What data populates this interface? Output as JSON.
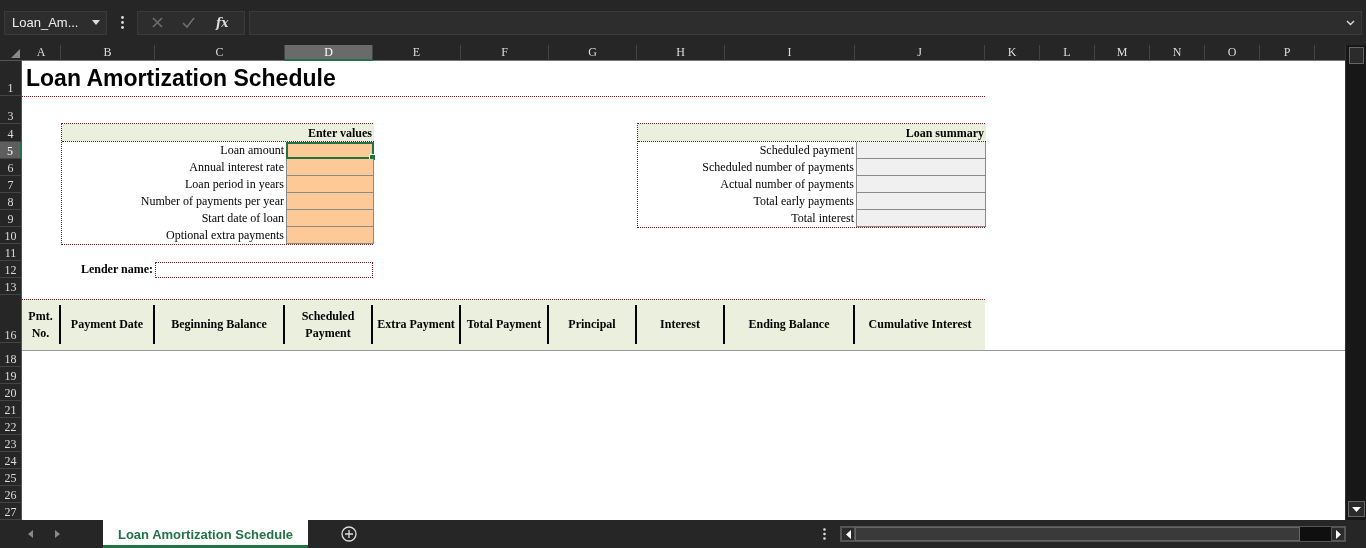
{
  "name_box": {
    "value": "Loan_Am..."
  },
  "formula_bar": {
    "function_label": "fx"
  },
  "columns": [
    {
      "label": "A",
      "selected": false
    },
    {
      "label": "B",
      "selected": false
    },
    {
      "label": "C",
      "selected": false
    },
    {
      "label": "D",
      "selected": true
    },
    {
      "label": "E",
      "selected": false
    },
    {
      "label": "F",
      "selected": false
    },
    {
      "label": "G",
      "selected": false
    },
    {
      "label": "H",
      "selected": false
    },
    {
      "label": "I",
      "selected": false
    },
    {
      "label": "J",
      "selected": false
    },
    {
      "label": "K",
      "selected": false
    },
    {
      "label": "L",
      "selected": false
    },
    {
      "label": "M",
      "selected": false
    },
    {
      "label": "N",
      "selected": false
    },
    {
      "label": "O",
      "selected": false
    },
    {
      "label": "P",
      "selected": false
    }
  ],
  "rows": [
    {
      "label": "1",
      "selected": false
    },
    {
      "label": "3",
      "selected": false
    },
    {
      "label": "4",
      "selected": false
    },
    {
      "label": "5",
      "selected": true
    },
    {
      "label": "6",
      "selected": false
    },
    {
      "label": "7",
      "selected": false
    },
    {
      "label": "8",
      "selected": false
    },
    {
      "label": "9",
      "selected": false
    },
    {
      "label": "10",
      "selected": false
    },
    {
      "label": "11",
      "selected": false
    },
    {
      "label": "12",
      "selected": false
    },
    {
      "label": "13",
      "selected": false
    },
    {
      "label": "16",
      "selected": false
    },
    {
      "label": "18",
      "selected": false
    },
    {
      "label": "19",
      "selected": false
    },
    {
      "label": "20",
      "selected": false
    },
    {
      "label": "21",
      "selected": false
    },
    {
      "label": "22",
      "selected": false
    },
    {
      "label": "23",
      "selected": false
    },
    {
      "label": "24",
      "selected": false
    },
    {
      "label": "25",
      "selected": false
    },
    {
      "label": "26",
      "selected": false
    },
    {
      "label": "27",
      "selected": false
    }
  ],
  "title": "Loan Amortization Schedule",
  "input_table": {
    "heading": "Enter values",
    "fields": [
      {
        "label": "Loan amount",
        "selected": true
      },
      {
        "label": "Annual interest rate",
        "selected": false
      },
      {
        "label": "Loan period in years",
        "selected": false
      },
      {
        "label": "Number of payments per year",
        "selected": false
      },
      {
        "label": "Start date of loan",
        "selected": false
      },
      {
        "label": "Optional extra payments",
        "selected": false
      }
    ]
  },
  "lender": {
    "label": "Lender name:"
  },
  "summary": {
    "heading": "Loan summary",
    "fields": [
      {
        "label": "Scheduled payment"
      },
      {
        "label": "Scheduled number of payments"
      },
      {
        "label": "Actual number of payments"
      },
      {
        "label": "Total early payments"
      },
      {
        "label": "Total interest"
      }
    ]
  },
  "schedule": {
    "columns": [
      "Pmt. No.",
      "Payment Date",
      "Beginning Balance",
      "Scheduled Payment",
      "Extra Payment",
      "Total Payment",
      "Principal",
      "Interest",
      "Ending Balance",
      "Cumulative Interest"
    ]
  },
  "sheet_tabs": [
    {
      "label": "Loan Amortization Schedule",
      "selected": true
    }
  ]
}
